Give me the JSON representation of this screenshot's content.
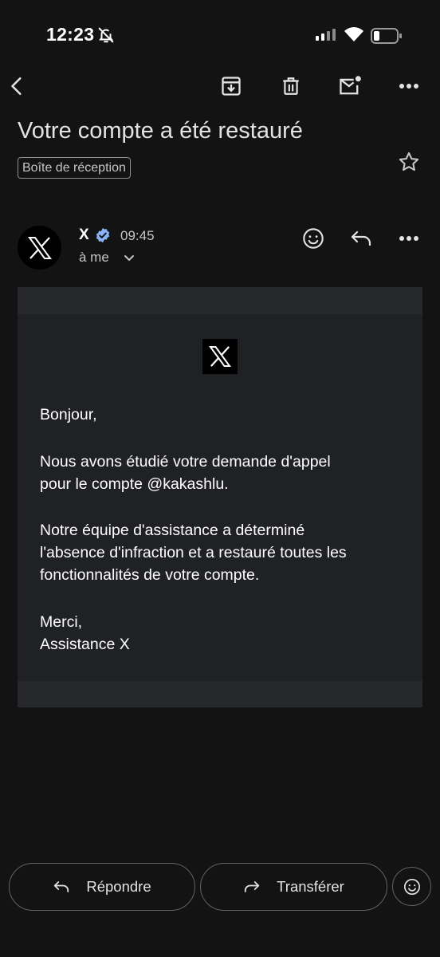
{
  "status_bar": {
    "time": "12:23"
  },
  "email": {
    "subject": "Votre compte a été restauré",
    "label": "Boîte de réception",
    "sender": {
      "name": "X",
      "time": "09:45",
      "recipient": "à me"
    },
    "body": {
      "greeting": "Bonjour,",
      "paragraph_1": "Nous avons étudié votre demande d'appel\npour le compte @kakashlu.",
      "paragraph_2": "Notre équipe d'assistance a déterminé\nl'absence d'infraction et a restauré toutes les\nfonctionnalités de votre compte.",
      "signoff": "Merci,\nAssistance X"
    }
  },
  "actions": {
    "reply_label": "Répondre",
    "forward_label": "Transférer"
  },
  "icons": {
    "back": "arrow-back-icon",
    "archive": "archive-icon",
    "delete": "trash-icon",
    "unread": "mark-unread-icon",
    "more": "more-horizontal-icon",
    "star": "star-icon",
    "verified": "verified-badge-icon",
    "emoji": "emoji-react-icon",
    "reply": "reply-icon",
    "forward": "forward-icon"
  },
  "colors": {
    "background": "#131314",
    "mail_body": "#202124",
    "verified_badge": "#8ab4f8"
  }
}
